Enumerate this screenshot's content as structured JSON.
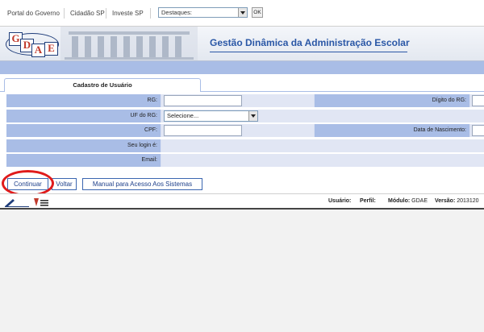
{
  "topnav": {
    "links": [
      "Portal do Governo",
      "Cidadão SP",
      "Investe SP"
    ],
    "destaques_value": "Destaques:",
    "ok_label": "OK"
  },
  "banner": {
    "logo_letters": [
      "G",
      "D",
      "A",
      "E"
    ],
    "title": "Gestão Dinâmica da Administração Escolar"
  },
  "tab": {
    "label": "Cadastro de Usuário"
  },
  "form": {
    "rg_label": "RG:",
    "digito_label": "Dígito do RG:",
    "uf_label": "UF do RG:",
    "uf_value": "Selecione...",
    "cpf_label": "CPF:",
    "nascimento_label": "Data de Nascimento:",
    "login_label": "Seu login é:",
    "email_label": "Email:"
  },
  "buttons": {
    "continuar": "Continuar",
    "voltar": "Voltar",
    "manual": "Manual para Acesso Aos Sistemas"
  },
  "footer": {
    "usuario_label": "Usuário:",
    "perfil_label": "Perfil:",
    "modulo_label": "Módulo:",
    "modulo_value": "GDAE",
    "versao_label": "Versão:",
    "versao_value": "2013120"
  },
  "colors": {
    "label_bg": "#a9bde6",
    "row_bg": "#d8dff2",
    "title_blue": "#2a57a6",
    "highlight_red": "#e01b1b"
  }
}
